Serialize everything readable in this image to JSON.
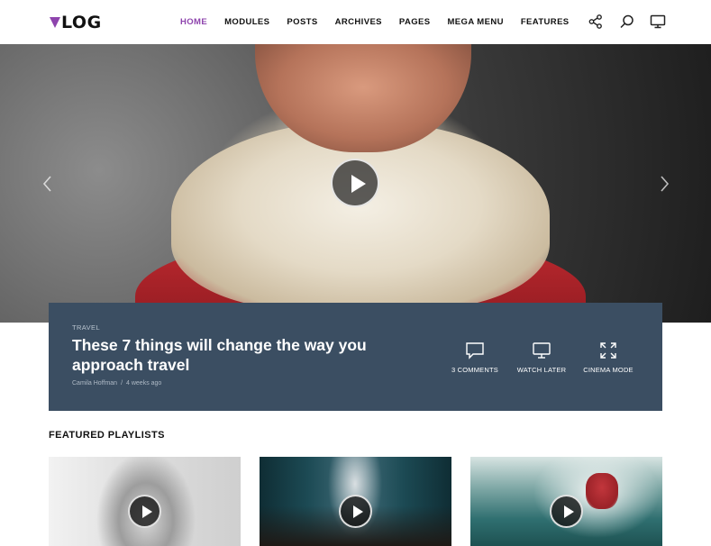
{
  "header": {
    "logo_text": "LOG",
    "logo_mark_color": "#8e44ad",
    "nav": [
      {
        "label": "HOME",
        "active": true
      },
      {
        "label": "MODULES"
      },
      {
        "label": "POSTS"
      },
      {
        "label": "ARCHIVES"
      },
      {
        "label": "PAGES"
      },
      {
        "label": "MEGA MENU"
      },
      {
        "label": "FEATURES"
      }
    ],
    "icons": [
      "share-icon",
      "search-icon",
      "monitor-icon"
    ]
  },
  "hero": {
    "play_icon": "play-icon",
    "prev_icon": "chevron-left-icon",
    "next_icon": "chevron-right-icon"
  },
  "post": {
    "category": "TRAVEL",
    "title": "These 7 things will change the way you approach travel",
    "author": "Camila Hoffman",
    "separator": "/",
    "time": "4 weeks ago",
    "actions": [
      {
        "icon": "comment-icon",
        "label": "3 COMMENTS"
      },
      {
        "icon": "monitor-icon",
        "label": "WATCH LATER"
      },
      {
        "icon": "expand-icon",
        "label": "CINEMA MODE"
      }
    ],
    "card_color": "#3b4e62"
  },
  "featured": {
    "title": "FEATURED PLAYLISTS"
  }
}
